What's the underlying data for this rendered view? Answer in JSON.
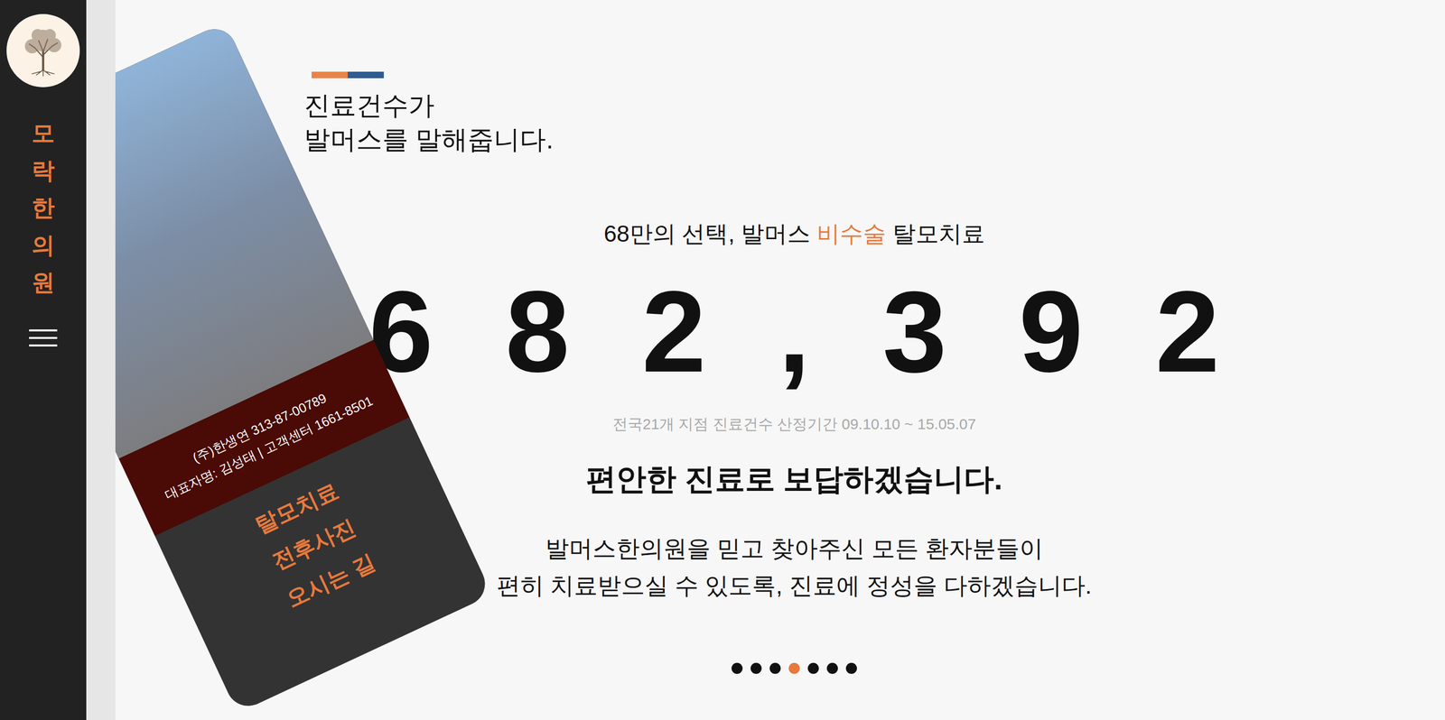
{
  "sidebar": {
    "brand": "모락한의원"
  },
  "header": {
    "title_lines": [
      "진료건수가",
      "발머스를 말해줍니다."
    ]
  },
  "stats": {
    "subtitle_before": "68만의 선택, 발머스 ",
    "subtitle_highlight": "비수술",
    "subtitle_after": " 탈모치료",
    "count": "682,392",
    "note": "전국21개 지점 진료건수 산정기간 09.10.10 ~ 15.05.07"
  },
  "message": {
    "heading": "편안한 진료로 보답하겠습니다.",
    "lines": [
      "발머스한의원을 믿고 찾아주신 모든 환자분들이",
      "편히 치료받으실 수 있도록, 진료에 정성을 다하겠습니다."
    ]
  },
  "card": {
    "company": "(주)한생연 313-87-00789",
    "contact": "대표자명: 김성태 | 고객센터 1661-8501",
    "links": [
      "탈모치료",
      "전후사진",
      "오시는 길"
    ]
  },
  "pagination": [
    {
      "selected": false
    },
    {
      "selected": false
    },
    {
      "selected": false
    },
    {
      "selected": true
    },
    {
      "selected": false
    },
    {
      "selected": false
    },
    {
      "selected": false
    }
  ]
}
